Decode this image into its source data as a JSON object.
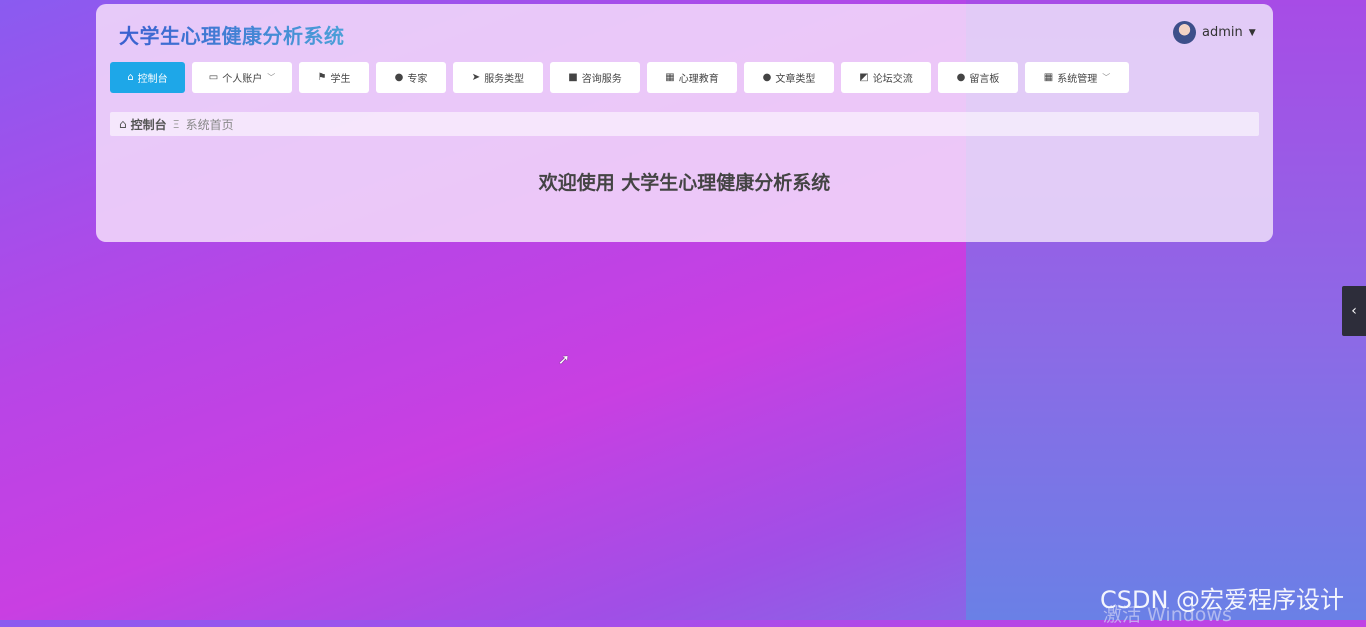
{
  "app": {
    "title": "大学生心理健康分析系统"
  },
  "user": {
    "name": "admin",
    "avatar_icon": "user-avatar"
  },
  "nav": {
    "items": [
      {
        "label": "控制台",
        "icon": "home-icon",
        "glyph": "⌂",
        "active": true,
        "dropdown": false
      },
      {
        "label": "个人账户",
        "icon": "wallet-icon",
        "glyph": "▭",
        "active": false,
        "dropdown": true
      },
      {
        "label": "学生",
        "icon": "flag-icon",
        "glyph": "⚑",
        "active": false,
        "dropdown": false
      },
      {
        "label": "专家",
        "icon": "user-icon",
        "glyph": "●",
        "active": false,
        "dropdown": false
      },
      {
        "label": "服务类型",
        "icon": "send-icon",
        "glyph": "➤",
        "active": false,
        "dropdown": false
      },
      {
        "label": "咨询服务",
        "icon": "video-icon",
        "glyph": "■",
        "active": false,
        "dropdown": false
      },
      {
        "label": "心理教育",
        "icon": "grid-icon",
        "glyph": "▦",
        "active": false,
        "dropdown": false
      },
      {
        "label": "文章类型",
        "icon": "user-icon",
        "glyph": "●",
        "active": false,
        "dropdown": false
      },
      {
        "label": "论坛交流",
        "icon": "chart-icon",
        "glyph": "◩",
        "active": false,
        "dropdown": false
      },
      {
        "label": "留言板",
        "icon": "bulb-icon",
        "glyph": "●",
        "active": false,
        "dropdown": false
      },
      {
        "label": "系统管理",
        "icon": "grid-icon",
        "glyph": "▦",
        "active": false,
        "dropdown": true
      }
    ]
  },
  "breadcrumb": {
    "root": "控制台",
    "separator": "Ξ",
    "current": "系统首页"
  },
  "main": {
    "welcome": "欢迎使用 大学生心理健康分析系统"
  },
  "watermarks": {
    "csdn": "CSDN @宏爱程序设计",
    "windows": "激活 Windows"
  },
  "colors": {
    "accent": "#1ea7e8",
    "title": "#3a5fd0",
    "sidebar_toggle": "#2d2d3a"
  }
}
